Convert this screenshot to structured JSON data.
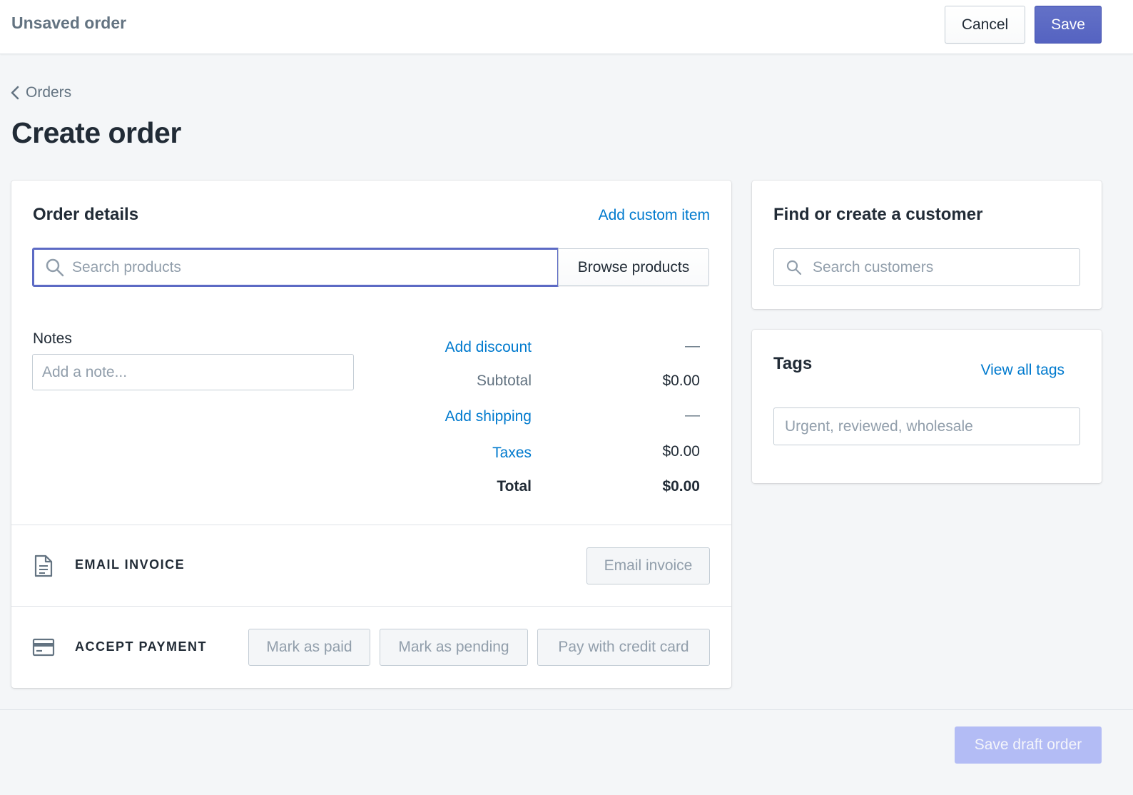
{
  "topbar": {
    "title": "Unsaved order",
    "cancel_label": "Cancel",
    "save_label": "Save"
  },
  "breadcrumb": {
    "label": "Orders"
  },
  "page_title": "Create order",
  "order_details": {
    "title": "Order details",
    "add_custom_item": "Add custom item",
    "search_placeholder": "Search products",
    "browse_label": "Browse products",
    "notes_label": "Notes",
    "notes_placeholder": "Add a note...",
    "totals": {
      "discount_label": "Add discount",
      "discount_value": "—",
      "subtotal_label": "Subtotal",
      "subtotal_value": "$0.00",
      "shipping_label": "Add shipping",
      "shipping_value": "—",
      "taxes_label": "Taxes",
      "taxes_value": "$0.00",
      "total_label": "Total",
      "total_value": "$0.00"
    },
    "email_invoice": {
      "heading": "EMAIL INVOICE",
      "button": "Email invoice"
    },
    "accept_payment": {
      "heading": "ACCEPT PAYMENT",
      "mark_paid": "Mark as paid",
      "mark_pending": "Mark as pending",
      "pay_card": "Pay with credit card"
    }
  },
  "customer": {
    "title": "Find or create a customer",
    "search_placeholder": "Search customers"
  },
  "tags": {
    "title": "Tags",
    "view_all": "View all tags",
    "placeholder": "Urgent, reviewed, wholesale"
  },
  "footer": {
    "save_draft": "Save draft order"
  },
  "colors": {
    "accent": "#5c6ac4",
    "link": "#007ace",
    "background": "#f4f6f8"
  }
}
